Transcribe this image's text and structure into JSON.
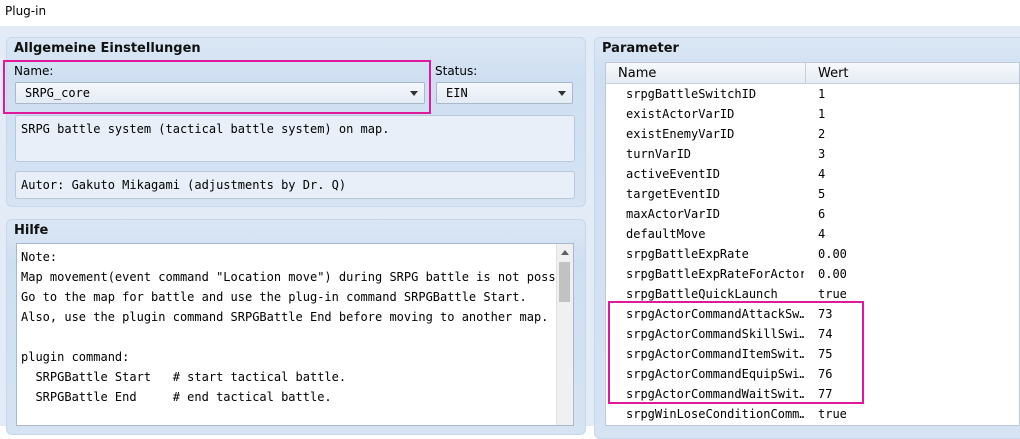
{
  "window": {
    "title": "Plug-in"
  },
  "general": {
    "title": "Allgemeine Einstellungen",
    "name_label": "Name:",
    "name_value": "SRPG_core",
    "status_label": "Status:",
    "status_value": "EIN",
    "description": "SRPG battle system (tactical battle system) on map.",
    "author": "Autor: Gakuto Mikagami (adjustments by Dr. Q)"
  },
  "help": {
    "title": "Hilfe",
    "lines": [
      "Note:",
      "Map movement(event command \"Location move\") during SRPG battle is not possible",
      "Go to the map for battle and use the plug-in command SRPGBattle Start.",
      "Also, use the plugin command SRPGBattle End before moving to another map.",
      "",
      "plugin command:",
      "  SRPGBattle Start   # start tactical battle.",
      "  SRPGBattle End     # end tactical battle."
    ]
  },
  "parameters": {
    "title": "Parameter",
    "col_name": "Name",
    "col_value": "Wert",
    "rows": [
      {
        "name": "srpgBattleSwitchID",
        "value": "1"
      },
      {
        "name": "existActorVarID",
        "value": "1"
      },
      {
        "name": "existEnemyVarID",
        "value": "2"
      },
      {
        "name": "turnVarID",
        "value": "3"
      },
      {
        "name": "activeEventID",
        "value": "4"
      },
      {
        "name": "targetEventID",
        "value": "5"
      },
      {
        "name": "maxActorVarID",
        "value": "6"
      },
      {
        "name": "defaultMove",
        "value": "4"
      },
      {
        "name": "srpgBattleExpRate",
        "value": "0.00"
      },
      {
        "name": "srpgBattleExpRateForActors",
        "value": "0.00"
      },
      {
        "name": "srpgBattleQuickLaunch",
        "value": "true"
      },
      {
        "name": "srpgActorCommandAttackSw…",
        "value": "73"
      },
      {
        "name": "srpgActorCommandSkillSwi…",
        "value": "74"
      },
      {
        "name": "srpgActorCommandItemSwit…",
        "value": "75"
      },
      {
        "name": "srpgActorCommandEquipSwi…",
        "value": "76"
      },
      {
        "name": "srpgActorCommandWaitSwit…",
        "value": "77"
      },
      {
        "name": "srpgWinLoseConditionComm…",
        "value": "true"
      }
    ]
  },
  "colors": {
    "highlight": "#e0189a",
    "panel": "#d5e3f3",
    "background": "#e3ecf6"
  }
}
